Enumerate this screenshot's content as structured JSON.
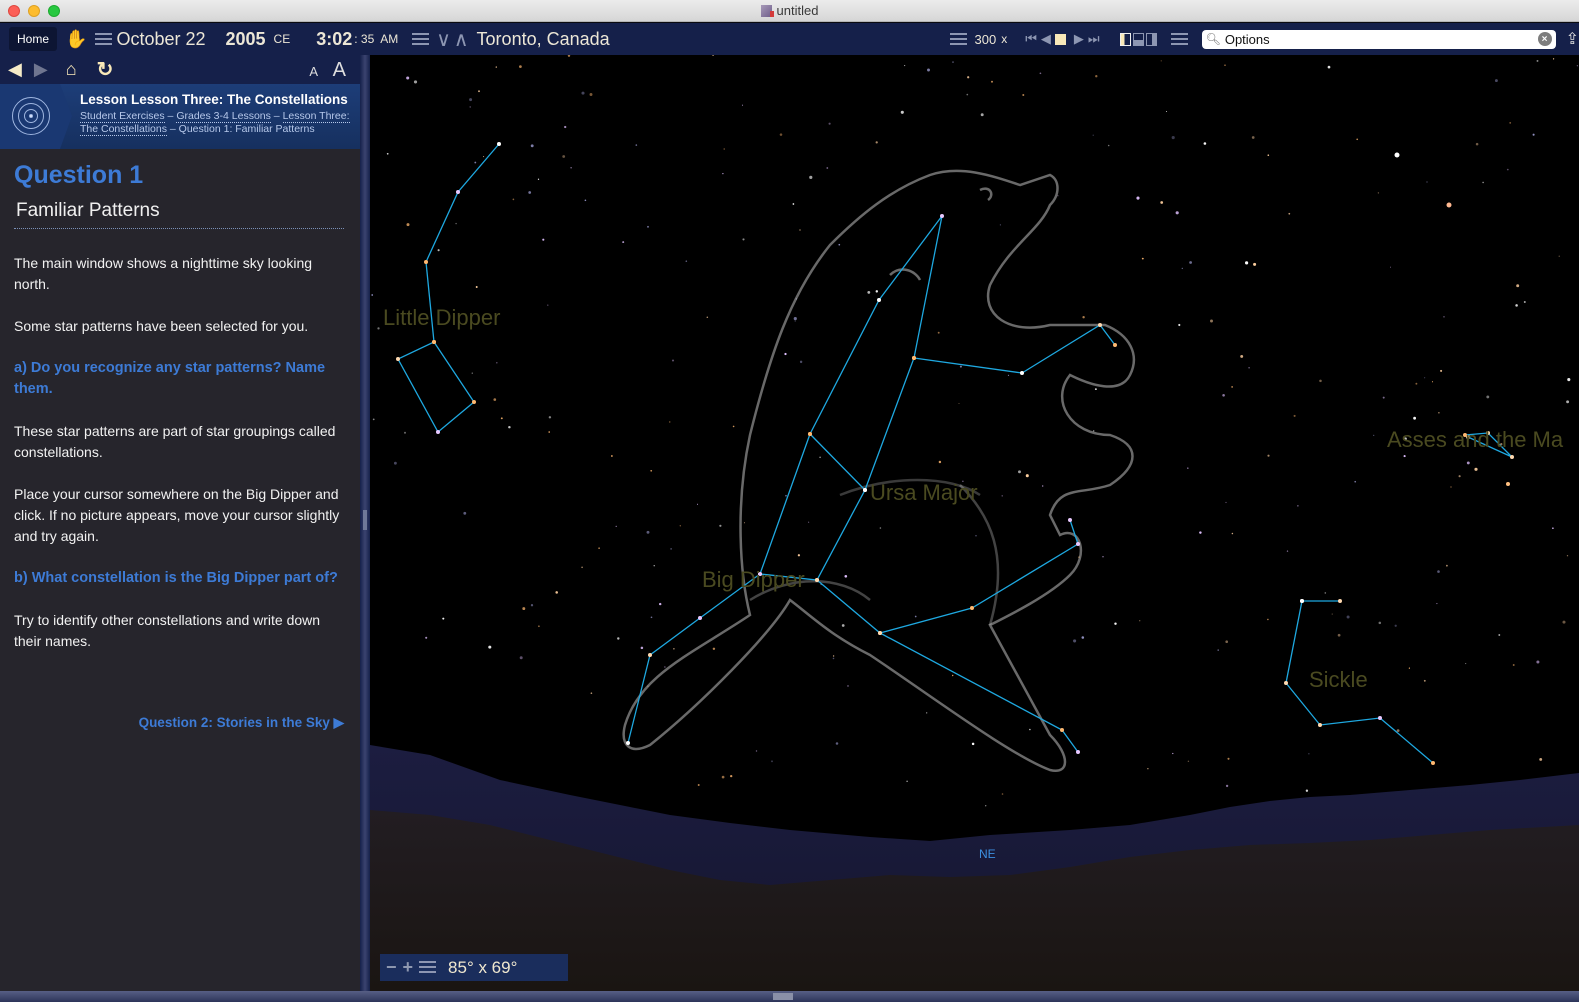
{
  "window": {
    "title": "untitled"
  },
  "toolbar": {
    "home_label": "Home",
    "date": "October 22",
    "year": "2005",
    "era": "CE",
    "time_hm": "3:02",
    "time_sec": ": 35",
    "ampm": "AM",
    "location": "Toronto, Canada",
    "time_rate": "300",
    "time_rate_unit": "x",
    "search": {
      "value": "Options",
      "placeholder": "Search"
    }
  },
  "navbar": {
    "font_small": "A",
    "font_large": "A"
  },
  "lesson": {
    "title": "Lesson Lesson Three: The Constellations",
    "breadcrumbs": [
      "Student Exercises",
      "Grades 3-4 Lessons",
      "Lesson Three: The Constellations",
      "Question 1: Familiar Patterns"
    ],
    "separator": " – "
  },
  "question": {
    "title": "Question 1",
    "subtitle": "Familiar Patterns",
    "para1": "The main window shows a nighttime sky looking north.",
    "para2": "Some star patterns have been selected for you.",
    "qa": "a) Do you recognize any star patterns? Name them.",
    "para3": "These star patterns are part of star groupings called constellations.",
    "para4": "Place your cursor somewhere on the Big Dipper and click. If no picture appears, move your cursor slightly and try again.",
    "qb": "b) What constellation is the Big Dipper part of?",
    "para5": "Try to identify other constellations and write down their names.",
    "next_link": "Question 2: Stories in the Sky ▶"
  },
  "sky": {
    "labels": {
      "little_dipper": "Little Dipper",
      "ursa_major": "Ursa Major",
      "big_dipper": "Big Dipper",
      "asses": "Asses and the Ma",
      "sickle": "Sickle"
    },
    "compass": "NE",
    "fov": "85° x 69°",
    "line_color": "#1ea8e0",
    "label_color": "#4a4a20"
  }
}
